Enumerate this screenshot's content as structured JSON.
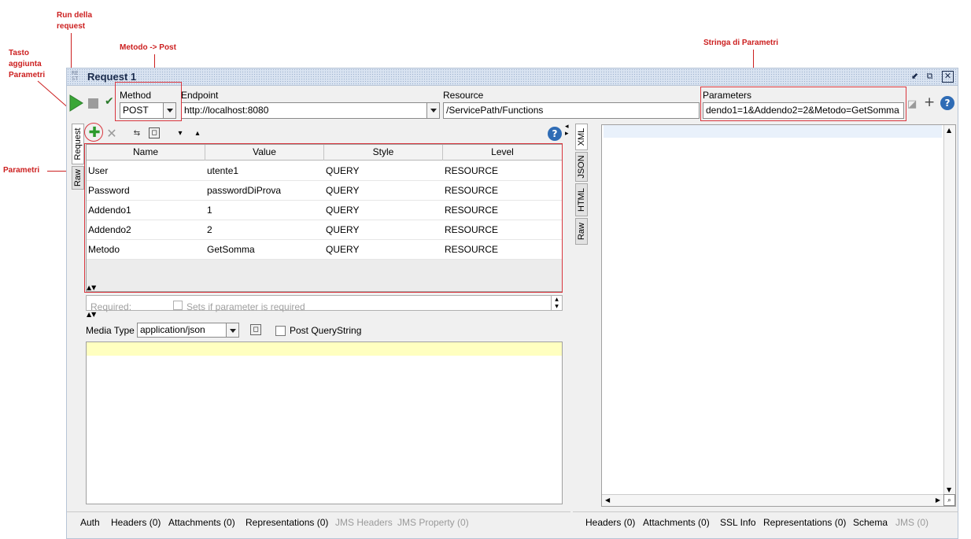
{
  "annotations": {
    "run": "Run della request",
    "run_l1": "Run della",
    "run_l2": "request",
    "method": "Metodo -> Post",
    "add_params_l1": "Tasto",
    "add_params_l2": "aggiunta",
    "add_params_l3": "Parametri",
    "params_string": "Stringa di Parametri",
    "params_table": "Parametri"
  },
  "window": {
    "title": "Request 1",
    "icon_text": "RE ST"
  },
  "request_bar": {
    "method_label": "Method",
    "method_value": "POST",
    "endpoint_label": "Endpoint",
    "endpoint_value": "http://localhost:8080",
    "resource_label": "Resource",
    "resource_value": "/ServicePath/Functions",
    "parameters_label": "Parameters",
    "parameters_value": "dendo1=1&Addendo2=2&Metodo=GetSomma"
  },
  "left_side_tabs": [
    "Request",
    "Raw"
  ],
  "response_side_tabs": [
    "XML",
    "JSON",
    "HTML",
    "Raw"
  ],
  "params_table": {
    "columns": [
      "Name",
      "Value",
      "Style",
      "Level"
    ],
    "rows": [
      [
        "User",
        "utente1",
        "QUERY",
        "RESOURCE"
      ],
      [
        "Password",
        "passwordDiProva",
        "QUERY",
        "RESOURCE"
      ],
      [
        "Addendo1",
        "1",
        "QUERY",
        "RESOURCE"
      ],
      [
        "Addendo2",
        "2",
        "QUERY",
        "RESOURCE"
      ],
      [
        "Metodo",
        "GetSomma",
        "QUERY",
        "RESOURCE"
      ]
    ]
  },
  "param_detail": {
    "required_label": "Required:",
    "required_hint": "Sets if parameter is required"
  },
  "media": {
    "label": "Media Type",
    "value": "application/json",
    "post_querystring": "Post QueryString"
  },
  "request_bottom_tabs": [
    {
      "label": "Auth",
      "enabled": true
    },
    {
      "label": "Headers (0)",
      "enabled": true
    },
    {
      "label": "Attachments (0)",
      "enabled": true
    },
    {
      "label": "Representations (0)",
      "enabled": true
    },
    {
      "label": "JMS Headers",
      "enabled": false
    },
    {
      "label": "JMS Property (0)",
      "enabled": false
    }
  ],
  "response_bottom_tabs": [
    {
      "label": "Headers (0)",
      "enabled": true
    },
    {
      "label": "Attachments (0)",
      "enabled": true
    },
    {
      "label": "SSL Info",
      "enabled": true
    },
    {
      "label": "Representations (0)",
      "enabled": true
    },
    {
      "label": "Schema",
      "enabled": true
    },
    {
      "label": "JMS (0)",
      "enabled": false
    }
  ],
  "colors": {
    "annotation": "#cc1f1f",
    "run_green": "#3aa637",
    "editor_yellow": "#ffffc0",
    "titlebar": "#d9e3f1"
  }
}
